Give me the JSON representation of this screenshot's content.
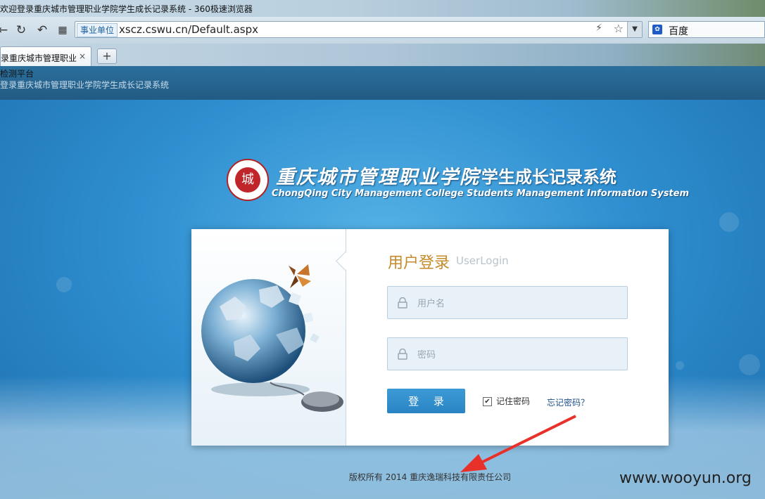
{
  "browser": {
    "window_title": "欢迎登录重庆城市管理职业学院学生成长记录系统 - 360极速浏览器",
    "address_badge": "事业单位",
    "url": "xscz.cswu.cn/Default.aspx",
    "search_engine": "百度",
    "tab_label": "录重庆城市管理职业",
    "tab_close": "×",
    "new_tab": "+",
    "nav_icons": [
      "back-icon",
      "refresh-icon",
      "undo-icon",
      "apps-icon",
      "flash-icon",
      "star-icon",
      "dropdown-icon"
    ]
  },
  "page": {
    "header_line1": "检测平台",
    "header_line2": "登录重庆城市管理职业学院学生成长记录系统",
    "logo_char": "城",
    "school_name": "重庆城市管理职业学院",
    "system_name": "学生成长记录系统",
    "school_name_en": "ChongQing City Management College Students Management Information System",
    "login": {
      "title": "用户登录",
      "subtitle": "UserLogin",
      "username_placeholder": "用户名",
      "password_placeholder": "密码",
      "submit_label": "登 录",
      "remember_label": "记住密码",
      "remember_checked": true,
      "forgot_label": "忘记密码？"
    },
    "copyright": "版权所有 2014 重庆逸瑞科技有限责任公司",
    "watermark": "www.wooyun.org"
  },
  "colors": {
    "background_blue": "#2f8fd0",
    "login_title": "#c58a2a",
    "login_button": "#2a84c4",
    "annotation_arrow": "#e8312a"
  }
}
